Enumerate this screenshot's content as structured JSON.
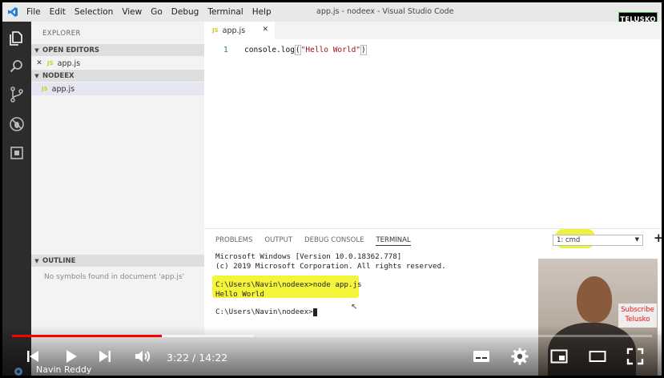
{
  "window": {
    "title": "app.js - nodeex - Visual Studio Code"
  },
  "menu": [
    "File",
    "Edit",
    "Selection",
    "View",
    "Go",
    "Debug",
    "Terminal",
    "Help"
  ],
  "badge": "TELUSKO",
  "sidebar": {
    "title": "EXPLORER",
    "open_editors": {
      "label": "OPEN EDITORS",
      "file": "app.js"
    },
    "project": {
      "label": "NODEEX",
      "file": "app.js"
    },
    "outline": {
      "label": "OUTLINE",
      "empty": "No symbols found in document 'app.js'"
    }
  },
  "editor": {
    "tab": "app.js",
    "lines": [
      {
        "number": "1",
        "fn": "console.log",
        "arg": "\"Hello World\""
      }
    ]
  },
  "panel": {
    "tabs": [
      "PROBLEMS",
      "OUTPUT",
      "DEBUG CONSOLE",
      "TERMINAL"
    ],
    "active_tab": "TERMINAL",
    "terminal_select": "1: cmd",
    "lines": [
      "Microsoft Windows [Version 10.0.18362.778]",
      "(c) 2019 Microsoft Corporation. All rights reserved.",
      "C:\\Users\\Navin\\nodeex>node app.js",
      "Hello World",
      "C:\\Users\\Navin\\nodeex>"
    ]
  },
  "overlay": {
    "subscribe": "Subscribe Telusko"
  },
  "video": {
    "time_current": "3:22",
    "time_total": "14:22",
    "time_display": "3:22 / 14:22",
    "progress": 0.234,
    "buffered": 0.378,
    "channel": "Navin Reddy"
  },
  "colors": {
    "accent": "#ff0000",
    "highlight": "#f4f43a",
    "activity_bar": "#2c2c2c"
  }
}
